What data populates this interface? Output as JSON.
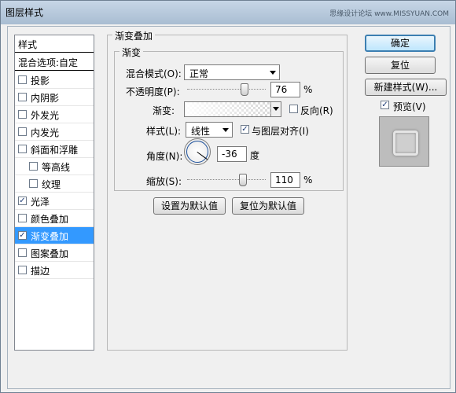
{
  "window": {
    "title": "图层样式",
    "watermark": "思缘设计论坛 www.MISSYUAN.COM"
  },
  "style_list": {
    "header": "样式",
    "blend_options": "混合选项:自定",
    "items": [
      {
        "label": "投影",
        "checked": false
      },
      {
        "label": "内阴影",
        "checked": false
      },
      {
        "label": "外发光",
        "checked": false
      },
      {
        "label": "内发光",
        "checked": false
      },
      {
        "label": "斜面和浮雕",
        "checked": false
      },
      {
        "label": "等高线",
        "checked": false
      },
      {
        "label": "纹理",
        "checked": false
      },
      {
        "label": "光泽",
        "checked": true
      },
      {
        "label": "颜色叠加",
        "checked": false
      },
      {
        "label": "渐变叠加",
        "checked": true,
        "selected": true
      },
      {
        "label": "图案叠加",
        "checked": false
      },
      {
        "label": "描边",
        "checked": false
      }
    ]
  },
  "panel": {
    "title": "渐变叠加",
    "group_title": "渐变",
    "blend_mode_label": "混合模式(O):",
    "blend_mode_value": "正常",
    "opacity_label": "不透明度(P):",
    "opacity_value": "76",
    "opacity_unit": "%",
    "opacity_fraction": 0.76,
    "gradient_label": "渐变:",
    "reverse_label": "反向(R)",
    "reverse_checked": false,
    "style_label": "样式(L):",
    "style_value": "线性",
    "align_label": "与图层对齐(I)",
    "align_checked": true,
    "angle_label": "角度(N):",
    "angle_value": "-36",
    "angle_unit": "度",
    "scale_label": "缩放(S):",
    "scale_value": "110",
    "scale_unit": "%",
    "scale_fraction": 0.73,
    "set_default": "设置为默认值",
    "reset_default": "复位为默认值"
  },
  "buttons": {
    "ok": "确定",
    "reset": "复位",
    "new_style": "新建样式(W)...",
    "preview_label": "预览(V)",
    "preview_checked": true
  }
}
